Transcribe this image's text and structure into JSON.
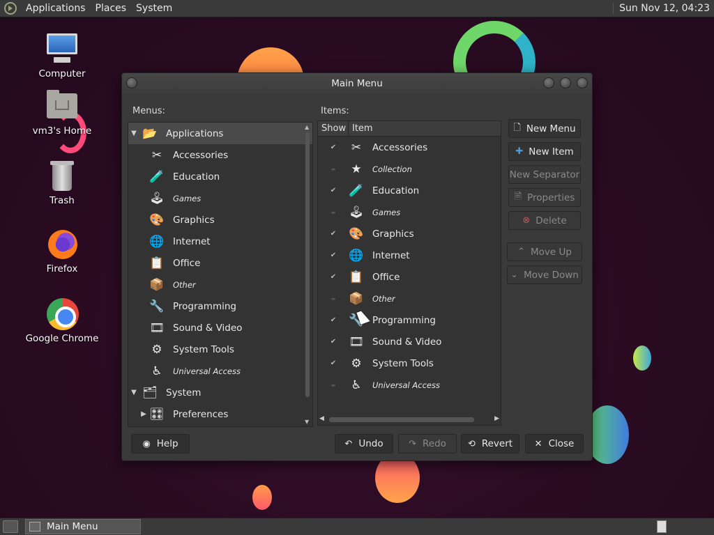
{
  "top_panel": {
    "menus": [
      "Applications",
      "Places",
      "System"
    ],
    "clock": "Sun Nov 12, 04:23"
  },
  "desktop": {
    "icons": [
      {
        "label": "Computer",
        "icon": "computer-icon"
      },
      {
        "label": "vm3's Home",
        "icon": "home-folder-icon"
      },
      {
        "label": "Trash",
        "icon": "trash-icon"
      },
      {
        "label": "Firefox",
        "icon": "firefox-icon"
      },
      {
        "label": "Google Chrome",
        "icon": "chrome-icon"
      }
    ]
  },
  "window": {
    "title": "Main Menu",
    "menus_label": "Menus:",
    "items_label": "Items:",
    "menus_tree": [
      {
        "label": "Applications",
        "level": 0,
        "expander": "▼",
        "selected": true,
        "italic": false,
        "icon": "📂"
      },
      {
        "label": "Accessories",
        "level": 1,
        "expander": "",
        "selected": false,
        "italic": false,
        "icon": "✂"
      },
      {
        "label": "Education",
        "level": 1,
        "expander": "",
        "selected": false,
        "italic": false,
        "icon": "🧪"
      },
      {
        "label": "Games",
        "level": 1,
        "expander": "",
        "selected": false,
        "italic": true,
        "icon": "🕹"
      },
      {
        "label": "Graphics",
        "level": 1,
        "expander": "",
        "selected": false,
        "italic": false,
        "icon": "🎨"
      },
      {
        "label": "Internet",
        "level": 1,
        "expander": "",
        "selected": false,
        "italic": false,
        "icon": "🌐"
      },
      {
        "label": "Office",
        "level": 1,
        "expander": "",
        "selected": false,
        "italic": false,
        "icon": "📋"
      },
      {
        "label": "Other",
        "level": 1,
        "expander": "",
        "selected": false,
        "italic": true,
        "icon": "📦"
      },
      {
        "label": "Programming",
        "level": 1,
        "expander": "",
        "selected": false,
        "italic": false,
        "icon": "🔧"
      },
      {
        "label": "Sound & Video",
        "level": 1,
        "expander": "",
        "selected": false,
        "italic": false,
        "icon": "🎞"
      },
      {
        "label": "System Tools",
        "level": 1,
        "expander": "",
        "selected": false,
        "italic": false,
        "icon": "⚙"
      },
      {
        "label": "Universal Access",
        "level": 1,
        "expander": "",
        "selected": false,
        "italic": true,
        "icon": "♿"
      },
      {
        "label": "System",
        "level": 0,
        "expander": "▼",
        "selected": false,
        "italic": false,
        "icon": "🗂"
      },
      {
        "label": "Preferences",
        "level": 1,
        "expander": "▶",
        "selected": false,
        "italic": false,
        "icon": "🎛"
      }
    ],
    "items_header": {
      "show": "Show",
      "item": "Item"
    },
    "items": [
      {
        "label": "Accessories",
        "show": true,
        "italic": false,
        "icon": "✂"
      },
      {
        "label": "Collection",
        "show": false,
        "italic": true,
        "icon": "★"
      },
      {
        "label": "Education",
        "show": true,
        "italic": false,
        "icon": "🧪"
      },
      {
        "label": "Games",
        "show": false,
        "italic": true,
        "icon": "🕹"
      },
      {
        "label": "Graphics",
        "show": true,
        "italic": false,
        "icon": "🎨"
      },
      {
        "label": "Internet",
        "show": true,
        "italic": false,
        "icon": "🌐"
      },
      {
        "label": "Office",
        "show": true,
        "italic": false,
        "icon": "📋"
      },
      {
        "label": "Other",
        "show": false,
        "italic": true,
        "icon": "📦"
      },
      {
        "label": "Programming",
        "show": true,
        "italic": false,
        "icon": "🔧"
      },
      {
        "label": "Sound & Video",
        "show": true,
        "italic": false,
        "icon": "🎞"
      },
      {
        "label": "System Tools",
        "show": true,
        "italic": false,
        "icon": "⚙"
      },
      {
        "label": "Universal Access",
        "show": false,
        "italic": true,
        "icon": "♿"
      }
    ],
    "side_buttons": [
      {
        "label": "New Menu",
        "enabled": true,
        "icon": "🗋"
      },
      {
        "label": "New Item",
        "enabled": true,
        "icon": "✚"
      },
      {
        "label": "New Separator",
        "enabled": false,
        "icon": ""
      },
      {
        "label": "Properties",
        "enabled": false,
        "icon": "🗎"
      },
      {
        "label": "Delete",
        "enabled": false,
        "icon": "⊗"
      },
      {
        "label": "Move Up",
        "enabled": false,
        "icon": "⌃"
      },
      {
        "label": "Move Down",
        "enabled": false,
        "icon": "⌄"
      }
    ],
    "bottom_buttons": {
      "help": "Help",
      "undo": "Undo",
      "redo": "Redo",
      "revert": "Revert",
      "close": "Close"
    }
  },
  "taskbar": {
    "task_label": "Main Menu"
  }
}
